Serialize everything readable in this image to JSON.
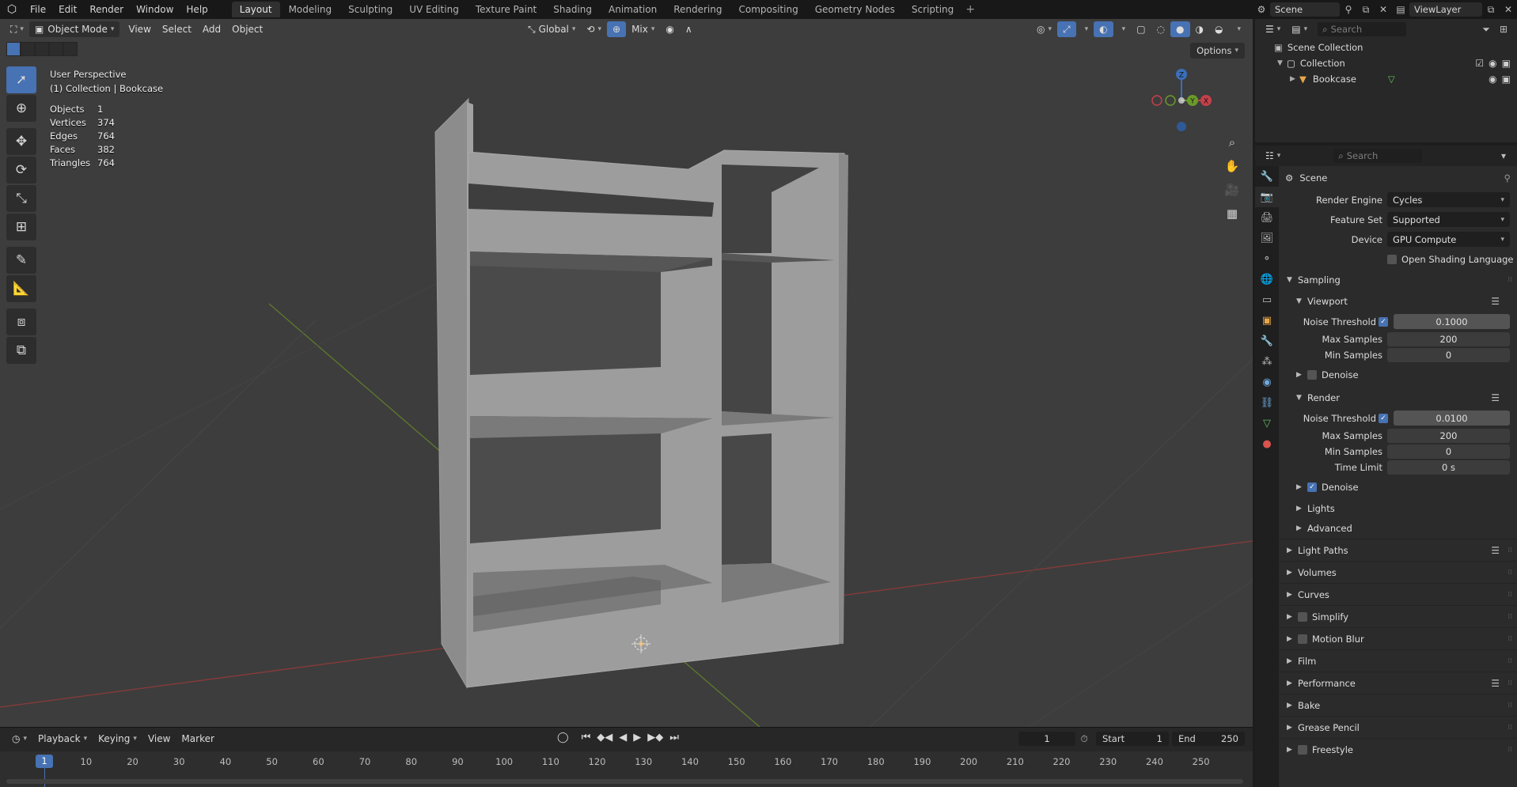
{
  "topbar": {
    "menus": [
      "File",
      "Edit",
      "Render",
      "Window",
      "Help"
    ],
    "workspaces": [
      "Layout",
      "Modeling",
      "Sculpting",
      "UV Editing",
      "Texture Paint",
      "Shading",
      "Animation",
      "Rendering",
      "Compositing",
      "Geometry Nodes",
      "Scripting"
    ],
    "active_workspace": "Layout",
    "scene_name": "Scene",
    "view_layer": "ViewLayer"
  },
  "viewport": {
    "mode": "Object Mode",
    "menus": [
      "View",
      "Select",
      "Add",
      "Object"
    ],
    "orientation": "Global",
    "snap_mode": "Mix",
    "options_label": "Options",
    "perspective": "User Perspective",
    "context": "(1) Collection | Bookcase",
    "stats": [
      {
        "k": "Objects",
        "v": "1"
      },
      {
        "k": "Vertices",
        "v": "374"
      },
      {
        "k": "Edges",
        "v": "764"
      },
      {
        "k": "Faces",
        "v": "382"
      },
      {
        "k": "Triangles",
        "v": "764"
      }
    ],
    "gizmo": {
      "x": "X",
      "y": "Y",
      "z": "Z"
    }
  },
  "timeline": {
    "menus": [
      "Playback",
      "Keying",
      "View",
      "Marker"
    ],
    "current_frame": "1",
    "start_label": "Start",
    "start": "1",
    "end_label": "End",
    "end": "250",
    "ticks": [
      "10",
      "20",
      "30",
      "40",
      "50",
      "60",
      "70",
      "80",
      "90",
      "100",
      "110",
      "120",
      "130",
      "140",
      "150",
      "160",
      "170",
      "180",
      "190",
      "200",
      "210",
      "220",
      "230",
      "240",
      "250"
    ],
    "playhead": "1"
  },
  "outliner": {
    "search_placeholder": "Search",
    "scene_collection": "Scene Collection",
    "collection": "Collection",
    "object": "Bookcase"
  },
  "properties": {
    "search_placeholder": "Search",
    "context": "Scene",
    "render_engine_label": "Render Engine",
    "render_engine": "Cycles",
    "feature_set_label": "Feature Set",
    "feature_set": "Supported",
    "device_label": "Device",
    "device": "GPU Compute",
    "osl_label": "Open Shading Language",
    "sampling": "Sampling",
    "viewport": "Viewport",
    "noise_threshold_label": "Noise Threshold",
    "vp_noise_threshold": "0.1000",
    "max_samples_label": "Max Samples",
    "vp_max_samples": "200",
    "min_samples_label": "Min Samples",
    "vp_min_samples": "0",
    "denoise_label": "Denoise",
    "render": "Render",
    "r_noise_threshold": "0.0100",
    "r_max_samples": "200",
    "r_min_samples": "0",
    "time_limit_label": "Time Limit",
    "r_time_limit": "0 s",
    "lights": "Lights",
    "advanced": "Advanced",
    "panels": [
      "Light Paths",
      "Volumes",
      "Curves",
      "Simplify",
      "Motion Blur",
      "Film",
      "Performance",
      "Bake",
      "Grease Pencil",
      "Freestyle"
    ]
  }
}
